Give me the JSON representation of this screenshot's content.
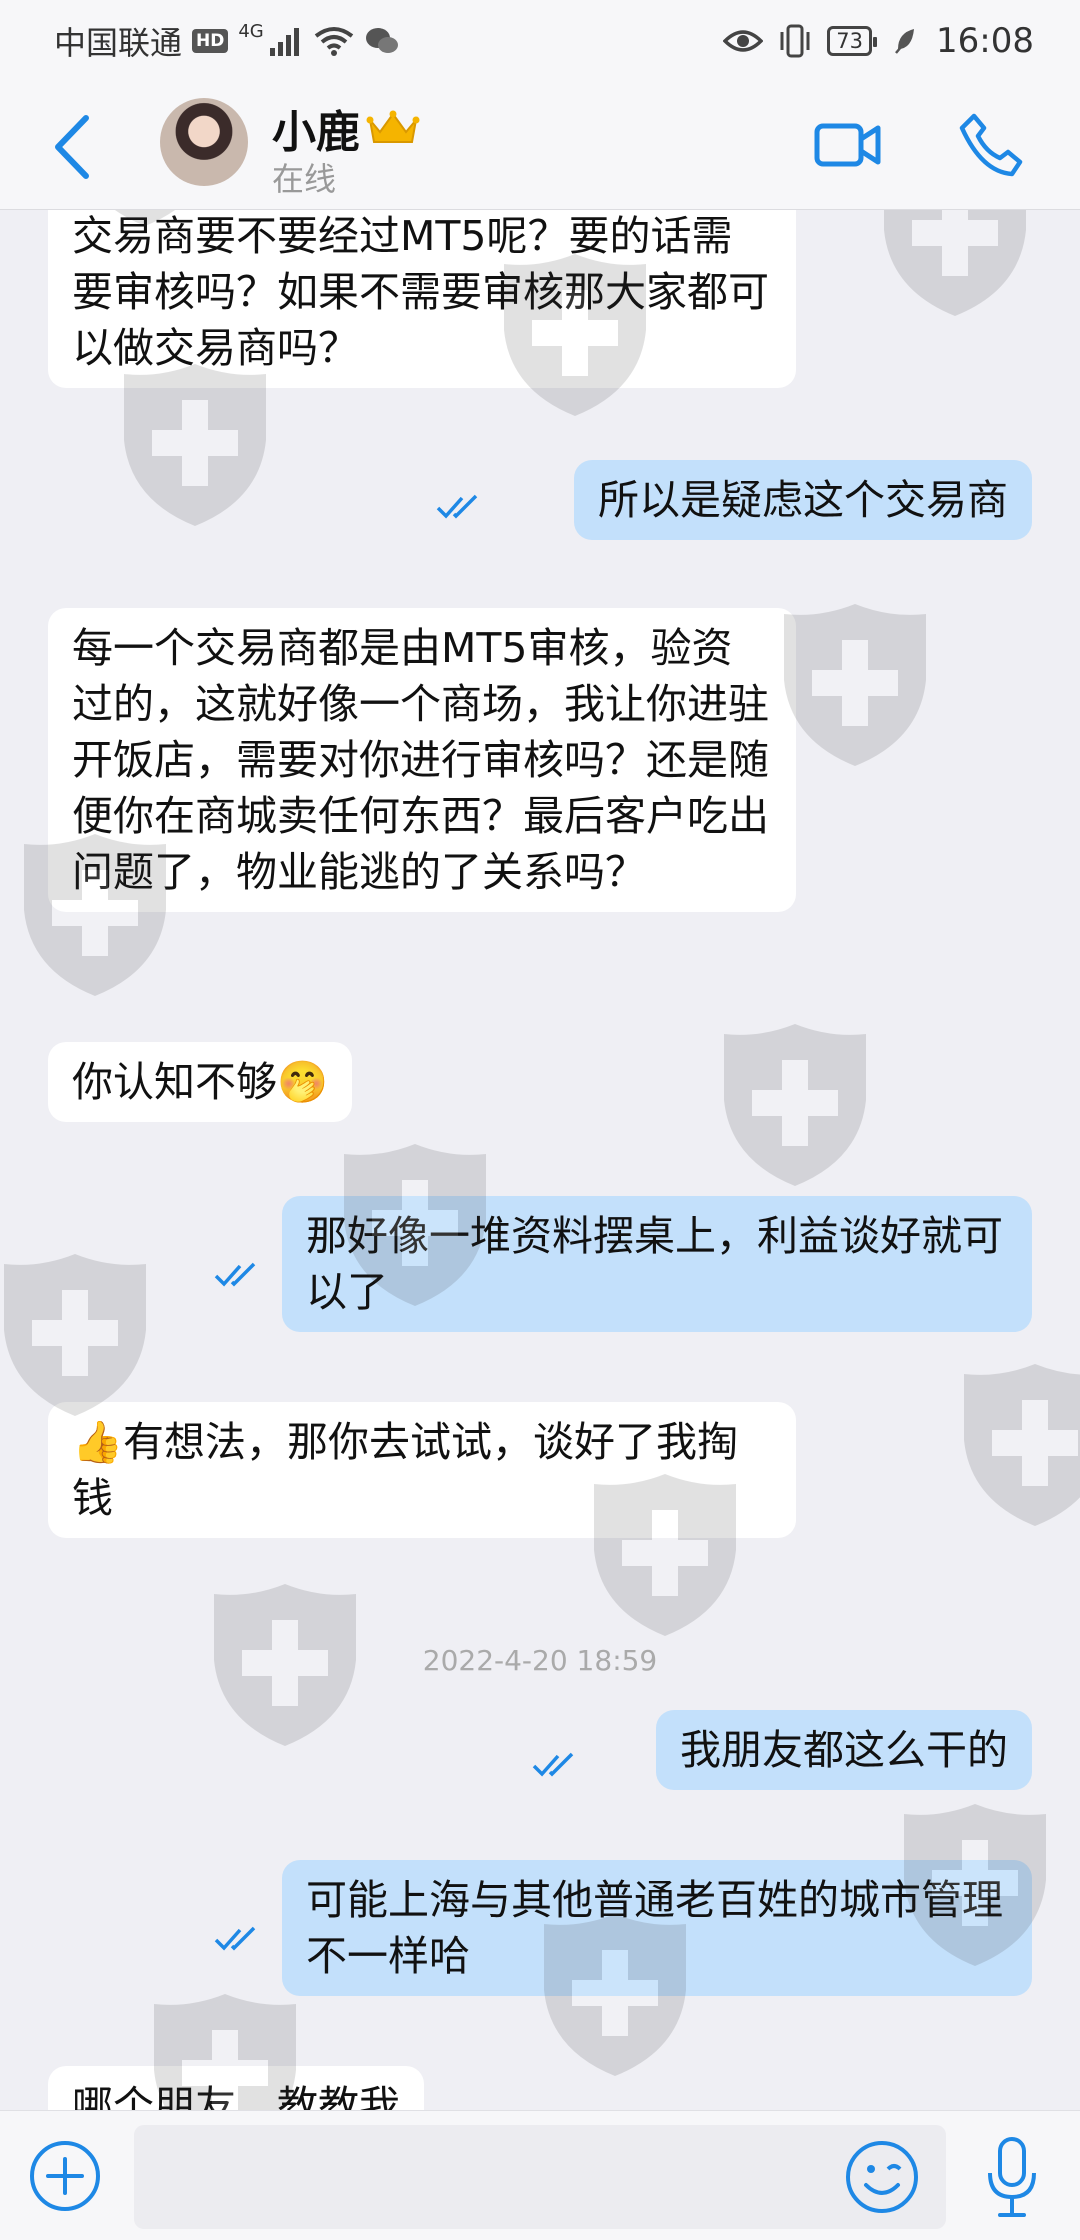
{
  "status_bar": {
    "carrier": "中国联通",
    "hd": "HD",
    "network": "4G",
    "battery": "73",
    "time": "16:08"
  },
  "header": {
    "name": "小鹿",
    "status": "在线"
  },
  "messages": [
    {
      "dir": "in",
      "text": "交易商要不要经过MT5呢？要的话需要审核吗？如果不需要审核那大家都可以做交易商吗？"
    },
    {
      "dir": "out",
      "text": "所以是疑虑这个交易商"
    },
    {
      "dir": "in",
      "text": "每一个交易商都是由MT5审核，验资过的，这就好像一个商场，我让你进驻开饭店，需要对你进行审核吗？还是随便你在商城卖任何东西？最后客户吃出问题了，物业能逃的了关系吗？"
    },
    {
      "dir": "in",
      "text": "你认知不够🤭"
    },
    {
      "dir": "out",
      "text": "那好像一堆资料摆桌上，利益谈好就可以了"
    },
    {
      "dir": "in",
      "text": "👍有想法，那你去试试，谈好了我掏钱"
    },
    {
      "dir": "out",
      "text": "我朋友都这么干的"
    },
    {
      "dir": "out",
      "text": "可能上海与其他普通老百姓的城市管理不一样哈"
    },
    {
      "dir": "in",
      "text": "哪个朋友，教教我"
    }
  ],
  "timestamp": "2022-4-20 18:59",
  "input": {
    "placeholder": ""
  },
  "colors": {
    "accent": "#1e88e5",
    "bubble_in": "#ffffff",
    "bubble_out": "#c3e0fb",
    "background": "#efeff4"
  },
  "icons": {
    "back": "chevron-left-icon",
    "video": "video-camera-icon",
    "call": "phone-icon",
    "add": "plus-circle-icon",
    "emoji": "emoji-icon",
    "mic": "microphone-icon",
    "read": "double-check-icon",
    "watermark": "shield-cross-icon"
  }
}
